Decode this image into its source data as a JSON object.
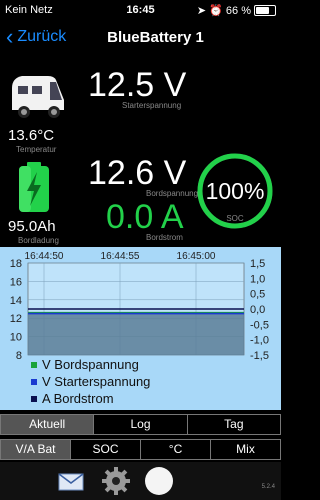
{
  "status": {
    "carrier": "Kein Netz",
    "time": "16:45",
    "battery": "66 %"
  },
  "nav": {
    "back_label": "Zurück",
    "title": "BlueBattery 1"
  },
  "camper": {
    "temperature": "13.6°C",
    "temperature_label": "Temperatur"
  },
  "battery": {
    "capacity": "95.0Ah",
    "capacity_label": "Bordladung"
  },
  "starter": {
    "voltage": "12.5 V",
    "label": "Starterspannung"
  },
  "board": {
    "voltage": "12.6 V",
    "voltage_label": "Bordspannung",
    "current": "0.0 A",
    "current_label": "Bordstrom"
  },
  "soc": {
    "value": "100%",
    "label": "SOC",
    "fraction": 1.0,
    "color": "#22d14a"
  },
  "chart_data": {
    "type": "line",
    "x_ticks": [
      "16:44:50",
      "16:44:55",
      "16:45:00"
    ],
    "y_left_ticks": [
      "18",
      "16",
      "14",
      "12",
      "10",
      "8"
    ],
    "y_left_range": [
      8,
      18
    ],
    "y_right_ticks": [
      "1,5",
      "1,0",
      "0,5",
      "0,0",
      "-0,5",
      "-1,0",
      "-1,5"
    ],
    "y_right_range": [
      -1.5,
      1.5
    ],
    "series": [
      {
        "name": "V Bordspannung",
        "axis": "left",
        "values": [
          12.6,
          12.6,
          12.6,
          12.6
        ],
        "color": "#1aa33a"
      },
      {
        "name": "V Starterspannung",
        "axis": "left",
        "values": [
          12.5,
          12.5,
          12.5,
          12.5
        ],
        "color": "#1a3ad0"
      },
      {
        "name": "A Bordstrom",
        "axis": "right",
        "values": [
          0.0,
          0.0,
          0.0,
          0.0
        ],
        "color": "#0a1050"
      }
    ],
    "grid": true
  },
  "tabs_top": [
    "Aktuell",
    "Log",
    "Tag"
  ],
  "tabs_bottom": [
    "V/A Bat",
    "SOC",
    "°C",
    "Mix"
  ],
  "version": "5.2.4",
  "colors": {
    "accent": "#1a8cff",
    "chart_bg": "#a8d8f8"
  }
}
